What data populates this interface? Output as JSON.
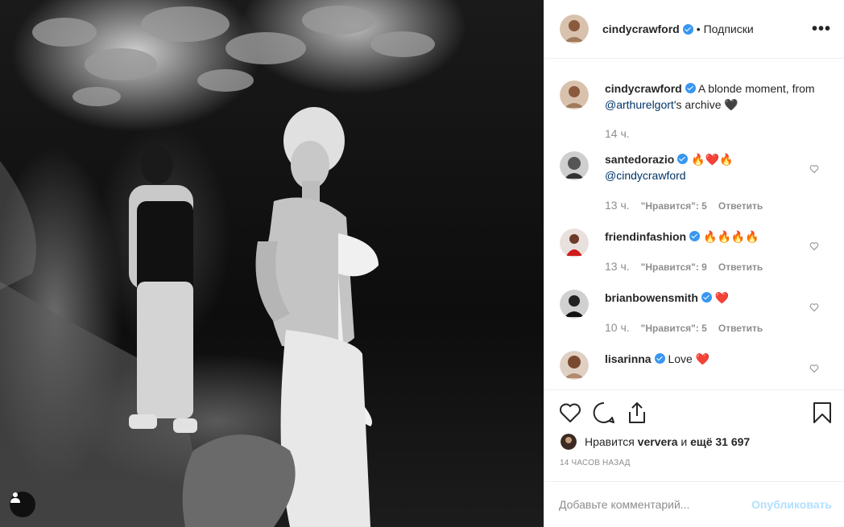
{
  "header": {
    "username": "cindycrawford",
    "separator": "•",
    "follow_label": "Подписки",
    "more_label": "•••"
  },
  "caption": {
    "username": "cindycrawford",
    "text_before": "A blonde moment, from ",
    "mention": "@arthurelgort",
    "text_after": "'s archive",
    "emoji": "🖤",
    "time": "14 ч."
  },
  "comments": [
    {
      "username": "santedorazio",
      "text": "🔥❤️🔥",
      "mention": "@cindycrawford",
      "time": "13 ч.",
      "likes": "\"Нравится\": 5",
      "reply": "Ответить"
    },
    {
      "username": "friendinfashion",
      "text": "🔥🔥🔥🔥",
      "time": "13 ч.",
      "likes": "\"Нравится\": 9",
      "reply": "Ответить"
    },
    {
      "username": "brianbowensmith",
      "text": "❤️",
      "time": "10 ч.",
      "likes": "\"Нравится\": 5",
      "reply": "Ответить"
    },
    {
      "username": "lisarinna",
      "text": "Love ❤️"
    }
  ],
  "likes": {
    "prefix": "Нравится",
    "user": "ververa",
    "middle": "и",
    "count_text": "ещё 31 697"
  },
  "post_time": "14 часов назад",
  "comment_input": {
    "placeholder": "Добавьте комментарий...",
    "publish_label": "Опубликовать"
  },
  "colors": {
    "verified": "#3897f0",
    "link": "#003569",
    "muted": "#8e8e8e",
    "publish_disabled": "#b2dffc"
  },
  "icons": [
    "heart-icon",
    "comment-icon",
    "share-icon",
    "bookmark-icon",
    "verified-badge-icon",
    "user-icon",
    "more-icon"
  ]
}
